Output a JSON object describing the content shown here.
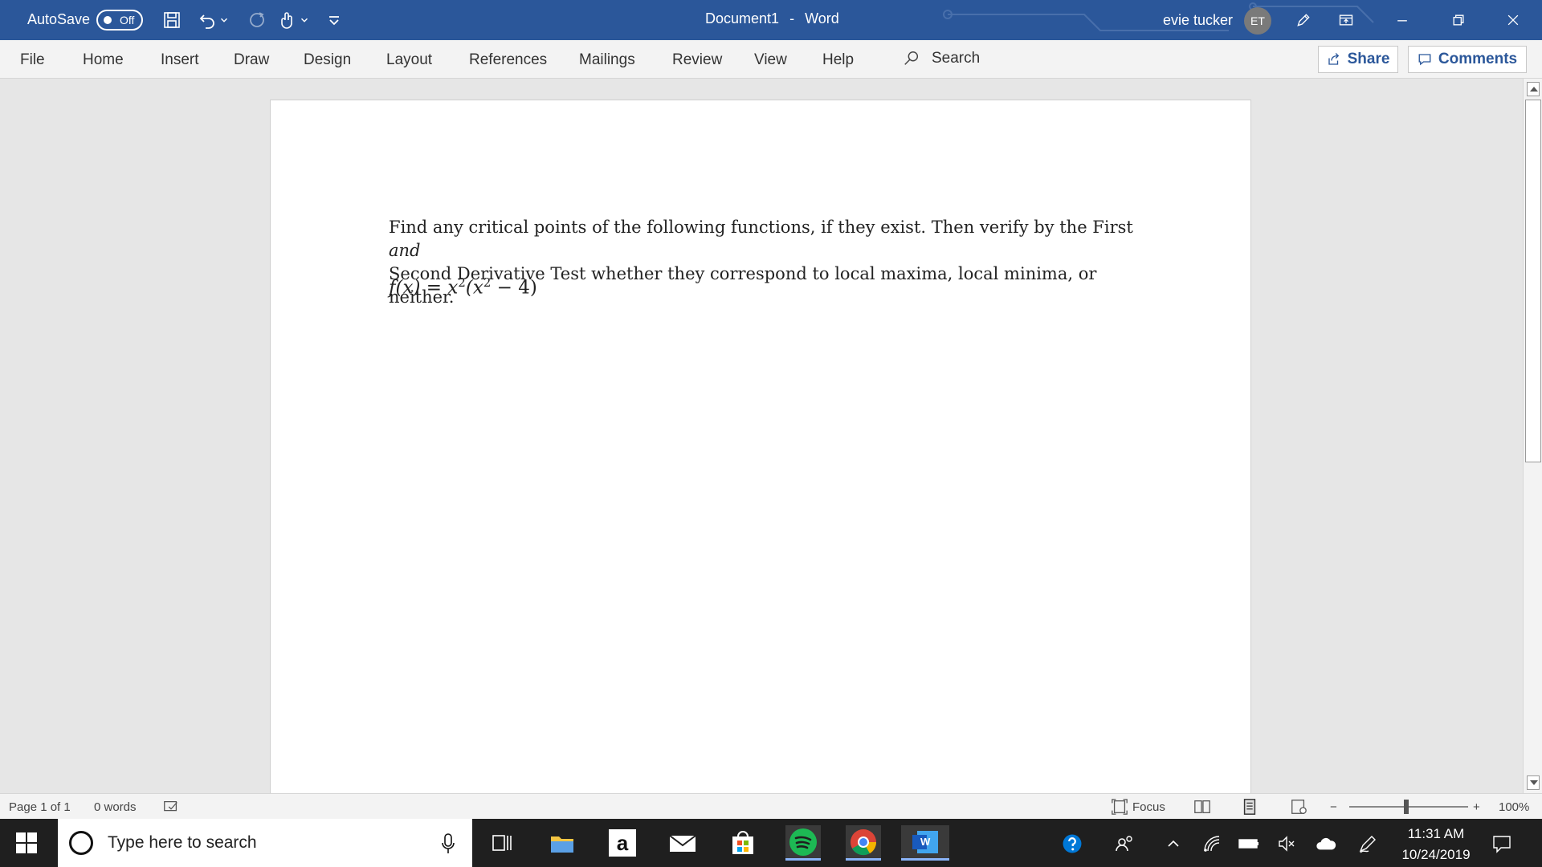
{
  "titlebar": {
    "autosave_label": "AutoSave",
    "autosave_state": "Off",
    "doc_name": "Document1",
    "separator": "-",
    "app_name": "Word",
    "user_name": "evie tucker",
    "user_initials": "ET",
    "bg_color": "#2b579a"
  },
  "ribbon": {
    "tabs": [
      "File",
      "Home",
      "Insert",
      "Draw",
      "Design",
      "Layout",
      "References",
      "Mailings",
      "Review",
      "View",
      "Help"
    ],
    "search_label": "Search",
    "share_label": "Share",
    "comments_label": "Comments"
  },
  "document": {
    "para_line1": "Find any critical points of the following functions, if they exist. Then verify by the First",
    "para_and": "and",
    "para_line2": "Second Derivative Test whether they correspond to local maxima, local minima, or neither.",
    "formula_lhs": "f(x) = x",
    "formula_exp1": "2",
    "formula_mid": "(x",
    "formula_exp2": "2",
    "formula_rhs": " − 4)"
  },
  "statusbar": {
    "page_info": "Page 1 of 1",
    "word_count": "0 words",
    "focus_label": "Focus",
    "zoom_minus": "−",
    "zoom_plus": "+",
    "zoom_level": "100%"
  },
  "taskbar": {
    "search_placeholder": "Type here to search",
    "amazon_letter": "a",
    "word_letter": "W",
    "time": "11:31 AM",
    "date": "10/24/2019"
  }
}
